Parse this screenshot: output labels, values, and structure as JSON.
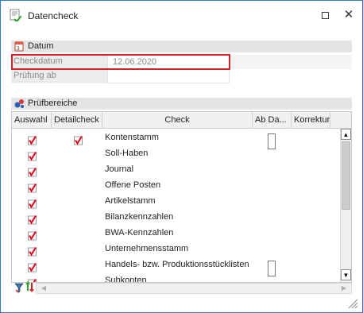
{
  "window": {
    "title": "Datencheck",
    "icons": {
      "app": "form-check-icon",
      "maximize": "maximize-icon",
      "close": "close-icon"
    },
    "close_glyph": "✕"
  },
  "datum": {
    "header": "Datum",
    "icon": "calendar-icon",
    "fields": [
      {
        "label": "Checkdatum",
        "value": "12.06.2020"
      },
      {
        "label": "Prüfung ab",
        "value": ""
      }
    ]
  },
  "pruefbereiche": {
    "header": "Prüfbereiche",
    "icon": "bubbles-icon",
    "columns": [
      "Auswahl",
      "Detailcheck",
      "Check",
      "Ab Da...",
      "Korrektur"
    ],
    "rows": [
      {
        "auswahl": true,
        "detailcheck": true,
        "check": "Kontenstamm",
        "ab_datum": "empty-checkbox"
      },
      {
        "auswahl": true,
        "detailcheck": false,
        "check": "Soll-Haben",
        "ab_datum": ""
      },
      {
        "auswahl": true,
        "detailcheck": false,
        "check": "Journal",
        "ab_datum": ""
      },
      {
        "auswahl": true,
        "detailcheck": false,
        "check": "Offene Posten",
        "ab_datum": ""
      },
      {
        "auswahl": true,
        "detailcheck": false,
        "check": "Artikelstamm",
        "ab_datum": ""
      },
      {
        "auswahl": true,
        "detailcheck": false,
        "check": "Bilanzkennzahlen",
        "ab_datum": ""
      },
      {
        "auswahl": true,
        "detailcheck": false,
        "check": "BWA-Kennzahlen",
        "ab_datum": ""
      },
      {
        "auswahl": true,
        "detailcheck": false,
        "check": "Unternehmensstamm",
        "ab_datum": ""
      },
      {
        "auswahl": true,
        "detailcheck": false,
        "check": "Handels- bzw. Produktionsstücklisten",
        "ab_datum": "empty-checkbox"
      },
      {
        "auswahl": true,
        "detailcheck": false,
        "check": "Subkonten",
        "ab_datum": ""
      }
    ],
    "scroll": {
      "up": "▲",
      "down": "▼",
      "left": "◀",
      "right": "▶"
    }
  },
  "footer": {
    "icons": [
      "filter-icon",
      "sort-icon"
    ]
  },
  "colors": {
    "highlight": "#d61f26",
    "checkmark": "#e2001a",
    "window_border": "#2b78c6",
    "section_header": "#e4e4e4"
  }
}
